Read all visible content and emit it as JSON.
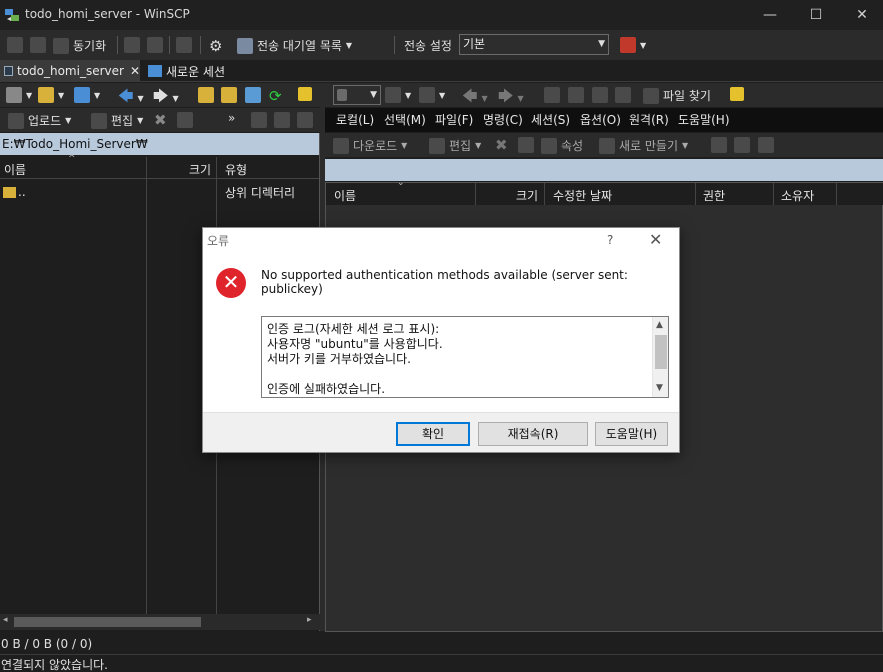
{
  "window": {
    "title": "todo_homi_server - WinSCP",
    "minimize": "—",
    "maximize": "☐",
    "close": "✕"
  },
  "toolbar": {
    "sync_label": "동기화",
    "queue_label": "전송 대기열 목록",
    "transfer_settings_label": "전송 설정",
    "transfer_settings_value": "기본"
  },
  "tabs": [
    {
      "label": "todo_homi_server",
      "close": "✕"
    },
    {
      "label": "새로운 세션"
    }
  ],
  "remote_toolbar": {
    "find_files_label": "파일 찾기"
  },
  "local_toolbar": {
    "upload_label": "업로드",
    "edit_label": "편집"
  },
  "menu": [
    "로컬(L)",
    "선택(M)",
    "파일(F)",
    "명령(C)",
    "세션(S)",
    "옵션(O)",
    "원격(R)",
    "도움말(H)"
  ],
  "remote_actions": {
    "download_label": "다운로드",
    "edit_label": "편집",
    "properties_label": "속성",
    "new_label": "새로 만들기"
  },
  "local_panel": {
    "path": "E:₩Todo_Homi_Server₩",
    "columns": {
      "name": "이름",
      "size": "크기",
      "type": "유형"
    },
    "rows": [
      {
        "name": "..",
        "type": "상위 디렉터리"
      }
    ]
  },
  "remote_panel": {
    "columns": {
      "name": "이름",
      "size": "크기",
      "modified": "수정한 날짜",
      "rights": "권한",
      "owner": "소유자"
    }
  },
  "dialog": {
    "title": "오류",
    "help": "?",
    "close": "✕",
    "message": "No supported authentication methods available (server sent: publickey)",
    "log_lines": [
      "인증 로그(자세한 세션 로그 표시):",
      "사용자명 \"ubuntu\"를 사용합니다.",
      "서버가 키를 거부하였습니다.",
      "",
      "인증에 실패하였습니다."
    ],
    "buttons": {
      "ok": "확인",
      "reconnect": "재접속(R)",
      "help": "도움말(H)"
    }
  },
  "status": {
    "transfer": "0 B / 0 B (0 / 0)",
    "connection": "연결되지 않았습니다."
  },
  "colors": {
    "path_bar": "#b8c9dc",
    "error": "#e0242c",
    "default_button_border": "#0078d7"
  }
}
